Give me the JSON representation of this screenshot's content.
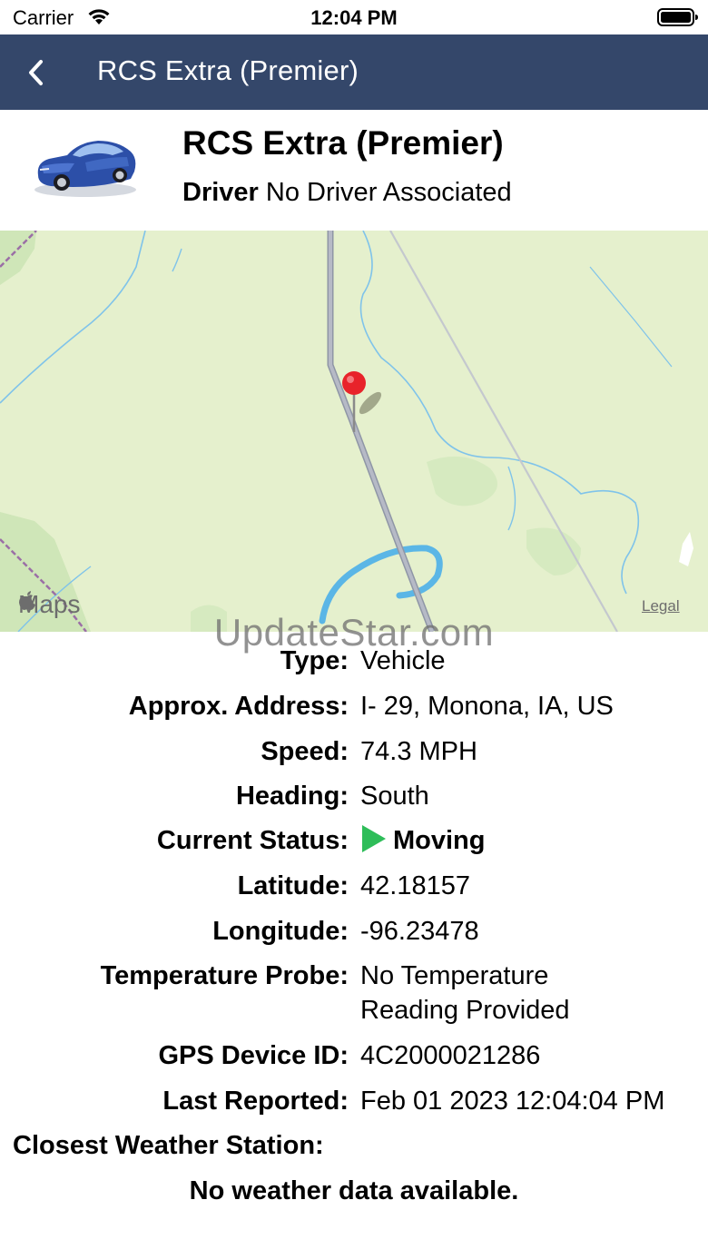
{
  "status_bar": {
    "carrier": "Carrier",
    "time": "12:04 PM"
  },
  "nav": {
    "title": "RCS Extra (Premier)",
    "back_icon": "chevron-left-icon"
  },
  "header": {
    "vehicle_name": "RCS Extra (Premier)",
    "driver_label": "Driver",
    "driver_value": "No Driver Associated"
  },
  "map": {
    "attribution": "Maps",
    "legal": "Legal",
    "pin_color": "#e8232a",
    "land_color": "#e5f0cd",
    "road_color": "#a3a8b8",
    "water_color": "#5bb6e6"
  },
  "watermark": "UpdateStar.com",
  "details": {
    "type_label": "Type:",
    "type_value": "Vehicle",
    "address_label": "Approx. Address:",
    "address_value": "I- 29, Monona, IA, US",
    "speed_label": "Speed:",
    "speed_value": "74.3 MPH",
    "heading_label": "Heading:",
    "heading_value": "South",
    "status_label": "Current Status:",
    "status_value": "Moving",
    "status_color": "#2ebd59",
    "latitude_label": "Latitude:",
    "latitude_value": "42.18157",
    "longitude_label": "Longitude:",
    "longitude_value": "-96.23478",
    "temp_label": "Temperature Probe:",
    "temp_value_line1": "No Temperature",
    "temp_value_line2": "Reading Provided",
    "gps_label": "GPS Device ID:",
    "gps_value": "4C2000021286",
    "reported_label": "Last Reported:",
    "reported_value": "Feb 01 2023 12:04:04 PM"
  },
  "weather": {
    "label": "Closest Weather Station:",
    "message": "No weather data available."
  }
}
